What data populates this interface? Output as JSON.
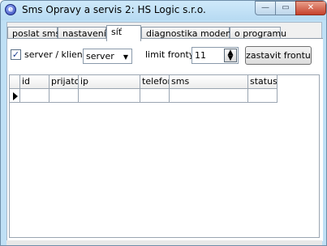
{
  "window": {
    "title": "Sms Opravy a servis 2: HS Logic s.r.o.",
    "icon": "app-icon",
    "min_glyph": "—",
    "max_glyph": "▭",
    "close_glyph": "✕"
  },
  "tabs": [
    {
      "label": "poslat sms"
    },
    {
      "label": "nastavení"
    },
    {
      "label": "síť"
    },
    {
      "label": "diagnostika modemu"
    },
    {
      "label": "o programu"
    }
  ],
  "active_tab": "síť",
  "controls": {
    "server_checkbox_checked": true,
    "server_checkbox_label": "server / klient",
    "mode_select_value": "server",
    "limit_label": "limit fronty",
    "limit_value": "11",
    "stop_button": "zastavit frontu"
  },
  "grid": {
    "columns": [
      "id",
      "prijato",
      "ip",
      "telefon",
      "sms",
      "status"
    ],
    "rows": [
      [
        "",
        "",
        "",
        "",
        "",
        ""
      ]
    ]
  }
}
